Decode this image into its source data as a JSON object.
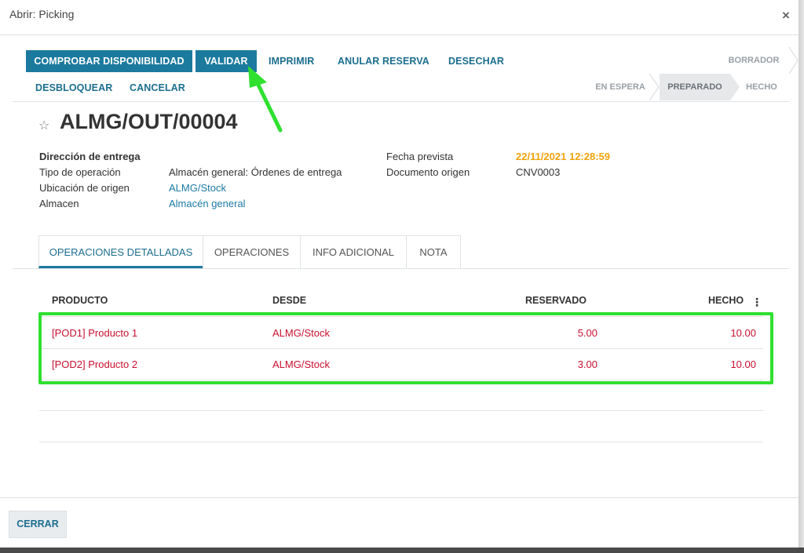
{
  "window": {
    "title": "Abrir: Picking",
    "close_glyph": "×"
  },
  "toolbar": {
    "check_availability": "COMPROBAR DISPONIBILIDAD",
    "validate": "VALIDAR",
    "print": "IMPRIMIR",
    "unreserve": "ANULAR RESERVA",
    "scrap": "DESECHAR",
    "unlock": "DESBLOQUEAR",
    "cancel": "CANCELAR"
  },
  "statusbar": {
    "draft": "BORRADOR",
    "waiting": "EN ESPERA",
    "ready": "PREPARADO",
    "done": "HECHO",
    "active": "PREPARADO"
  },
  "record": {
    "name": "ALMG/OUT/00004",
    "star_glyph": "☆",
    "delivery_address_label": "Dirección de entrega",
    "operation_type_label": "Tipo de operación",
    "operation_type_value": "Almacén general: Órdenes de entrega",
    "source_location_label": "Ubicación de origen",
    "source_location_value": "ALMG/Stock",
    "warehouse_label": "Almacen",
    "warehouse_value": "Almacén general",
    "scheduled_date_label": "Fecha prevista",
    "scheduled_date_value": "22/11/2021 12:28:59",
    "source_document_label": "Documento origen",
    "source_document_value": "CNV0003"
  },
  "tabs": [
    {
      "label": "OPERACIONES DETALLADAS",
      "active": true
    },
    {
      "label": "OPERACIONES",
      "active": false
    },
    {
      "label": "INFO ADICIONAL",
      "active": false
    },
    {
      "label": "NOTA",
      "active": false
    }
  ],
  "table": {
    "columns": {
      "product": "PRODUCTO",
      "from": "DESDE",
      "reserved": "RESERVADO",
      "done": "HECHO"
    },
    "kebab_glyph": "⋮",
    "rows": [
      {
        "product": "[POD1] Producto 1",
        "from": "ALMG/Stock",
        "reserved": "5.00",
        "done": "10.00"
      },
      {
        "product": "[POD2] Producto 2",
        "from": "ALMG/Stock",
        "reserved": "3.00",
        "done": "10.00"
      }
    ]
  },
  "footer": {
    "close": "CERRAR"
  },
  "colors": {
    "primary": "#1c7a9e",
    "link": "#1c7aa6",
    "danger_text": "#c8102e",
    "highlight": "#2fe02f",
    "date": "#f0a30a"
  }
}
